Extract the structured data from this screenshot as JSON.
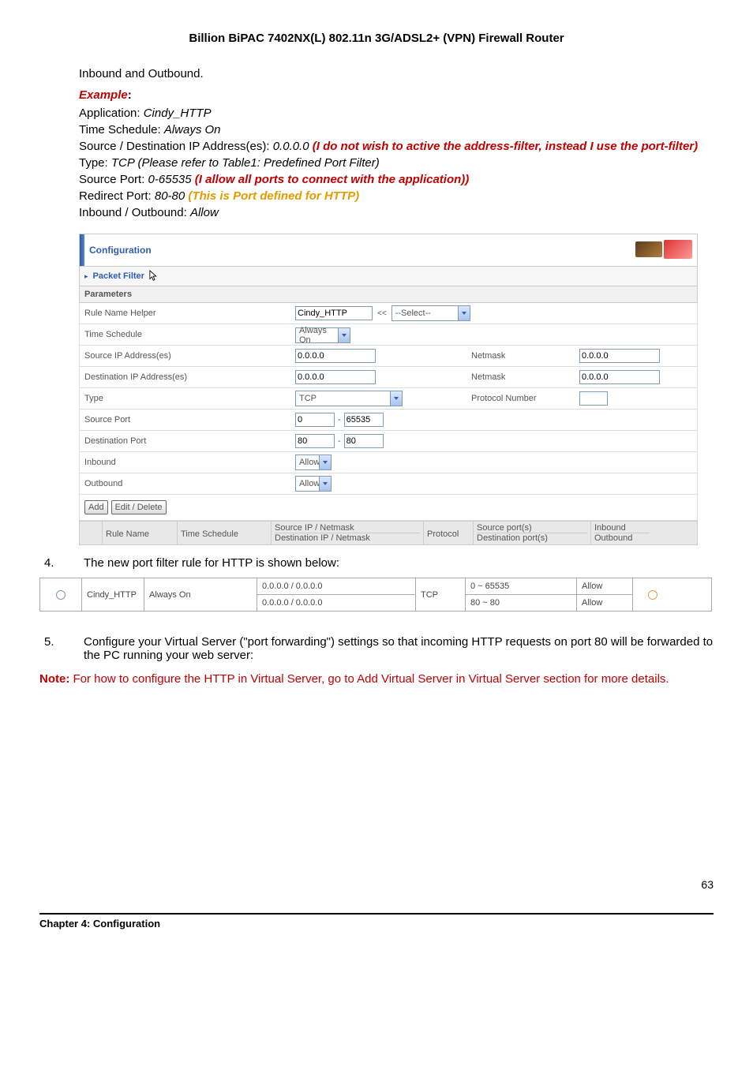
{
  "page_title": "Billion BiPAC 7402NX(L) 802.11n 3G/ADSL2+ (VPN) Firewall Router",
  "intro_line": "Inbound and Outbound.",
  "example_label": "Example",
  "example": {
    "application_label": "Application: ",
    "application_value": "Cindy_HTTP",
    "time_label": "Time Schedule: ",
    "time_value": "Always On",
    "sdip_label": "Source / Destination IP Address(es): ",
    "sdip_value": "0.0.0.0 ",
    "sdip_note": "(I do not wish to active the address-filter, instead I use the port-filter)",
    "type_label": "Type: ",
    "type_value": "TCP (Please refer to Table1: Predefined Port Filter)",
    "sport_label": "Source Port: ",
    "sport_value": "0-65535 ",
    "sport_note": "(I allow all ports to connect with the application))",
    "rport_label": "Redirect Port: ",
    "rport_value": "80-80 ",
    "rport_note": "(This is Port defined for HTTP)",
    "iob_label": "Inbound / Outbound: ",
    "iob_value": "Allow"
  },
  "config": {
    "header": "Configuration",
    "sub_link": "Packet Filter",
    "params_header": "Parameters",
    "rulename_lab": "Rule Name  Helper",
    "rulename_val": "Cindy_HTTP",
    "select_helper": "--Select--",
    "ltlt": "<<",
    "time_lab": "Time Schedule",
    "time_val": "Always On",
    "srcip_lab": "Source IP Address(es)",
    "srcip_val": "0.0.0.0",
    "netmask_lab": "Netmask",
    "srcnm_val": "0.0.0.0",
    "dstip_lab": "Destination IP Address(es)",
    "dstip_val": "0.0.0.0",
    "dstnm_val": "0.0.0.0",
    "type_lab": "Type",
    "type_val": "TCP",
    "protnum_lab": "Protocol Number",
    "srcport_lab": "Source Port",
    "srcport_from": "0",
    "srcport_to": "65535",
    "dash": "-",
    "dstport_lab": "Destination Port",
    "dstport_from": "80",
    "dstport_to": "80",
    "inbound_lab": "Inbound",
    "inbound_val": "Allow",
    "outbound_lab": "Outbound",
    "outbound_val": "Allow",
    "add_btn": "Add",
    "edit_btn": "Edit / Delete",
    "head_rule": "Rule Name",
    "head_time": "Time Schedule",
    "head_srcipnm": "Source IP / Netmask",
    "head_dstipnm": "Destination IP / Netmask",
    "head_proto": "Protocol",
    "head_sport": "Source port(s)",
    "head_dport": "Destination port(s)",
    "head_in": "Inbound",
    "head_out": "Outbound"
  },
  "step4_num": "4.",
  "step4_text": "The new port filter rule for HTTP is shown below:",
  "result": {
    "rule": "Cindy_HTTP",
    "time": "Always On",
    "ipnm1": "0.0.0.0 / 0.0.0.0",
    "ipnm2": "0.0.0.0 / 0.0.0.0",
    "proto": "TCP",
    "sport": "0 ~ 65535",
    "dport": "80 ~ 80",
    "allow1": "Allow",
    "allow2": "Allow"
  },
  "step5_num": "5.",
  "step5_text": "Configure your Virtual Server (\"port forwarding\") settings so that incoming HTTP requests on port 80 will be forwarded to the PC running your web server:",
  "note_label": "Note: ",
  "note_text": "For how to configure the HTTP in Virtual Server, go to Add Virtual Server in Virtual Server section for more details.",
  "chapter": "Chapter 4: Configuration",
  "page_number": "63"
}
